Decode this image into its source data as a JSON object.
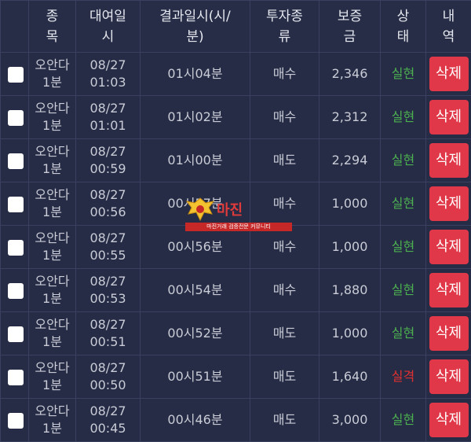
{
  "colors": {
    "background": "#1d2237",
    "delete_button": "#e03848",
    "status_success": "#4caf50",
    "status_fail": "#e03030",
    "checkbox": "#ffffff"
  },
  "headers": {
    "select": "",
    "item": "종\n목",
    "rent_time": "대여일\n시",
    "result_time": "결과일시(시/\n분)",
    "type": "투자종\n류",
    "deposit": "보증\n금",
    "status": "상\n태",
    "action": "내\n역"
  },
  "rows": [
    {
      "item": "오안다\n1분",
      "rent": "08/27\n01:03",
      "result": "01시04분",
      "type": "매수",
      "deposit": "2,346",
      "status": "실현",
      "ok": true,
      "del": "삭제"
    },
    {
      "item": "오안다\n1분",
      "rent": "08/27\n01:01",
      "result": "01시02분",
      "type": "매수",
      "deposit": "2,312",
      "status": "실현",
      "ok": true,
      "del": "삭제"
    },
    {
      "item": "오안다\n1분",
      "rent": "08/27\n00:59",
      "result": "01시00분",
      "type": "매도",
      "deposit": "2,294",
      "status": "실현",
      "ok": true,
      "del": "삭제"
    },
    {
      "item": "오안다\n1분",
      "rent": "08/27\n00:56",
      "result": "00시57분",
      "type": "매수",
      "deposit": "1,000",
      "status": "실현",
      "ok": true,
      "del": "삭제"
    },
    {
      "item": "오안다\n1분",
      "rent": "08/27\n00:55",
      "result": "00시56분",
      "type": "매수",
      "deposit": "1,000",
      "status": "실현",
      "ok": true,
      "del": "삭제"
    },
    {
      "item": "오안다\n1분",
      "rent": "08/27\n00:53",
      "result": "00시54분",
      "type": "매수",
      "deposit": "1,880",
      "status": "실현",
      "ok": true,
      "del": "삭제"
    },
    {
      "item": "오안다\n1분",
      "rent": "08/27\n00:51",
      "result": "00시52분",
      "type": "매도",
      "deposit": "1,000",
      "status": "실현",
      "ok": true,
      "del": "삭제"
    },
    {
      "item": "오안다\n1분",
      "rent": "08/27\n00:50",
      "result": "00시51분",
      "type": "매도",
      "deposit": "1,640",
      "status": "실격",
      "ok": false,
      "del": "삭제"
    },
    {
      "item": "오안다\n1분",
      "rent": "08/27\n00:45",
      "result": "00시46분",
      "type": "매도",
      "deposit": "3,000",
      "status": "실현",
      "ok": true,
      "del": "삭제"
    }
  ],
  "watermark": {
    "text": "마진",
    "sub": "마진거래 검증전문 커뮤니티"
  }
}
